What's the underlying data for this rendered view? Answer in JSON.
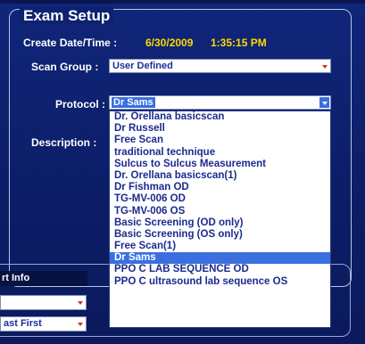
{
  "exam_setup": {
    "title": "Exam Setup",
    "create_label": "Create Date/Time :",
    "create_date": "6/30/2009",
    "create_time": "1:35:15 PM",
    "scan_group_label": "Scan Group :",
    "scan_group_value": "User Defined",
    "protocol_label": "Protocol :",
    "protocol_value": "Dr Sams",
    "description_label": "Description :"
  },
  "protocol_dropdown": {
    "options": [
      "Dr. Orellana basicscan",
      "Dr Russell",
      "Free Scan",
      "traditional technique",
      "Sulcus to Sulcus Measurement",
      "Dr. Orellana basicscan(1)",
      "Dr Fishman OD",
      "TG-MV-006 OD",
      "TG-MV-006 OS",
      "Basic Screening (OD only)",
      "Basic Screening (OS only)",
      "Free Scan(1)",
      "Dr Sams",
      "PPO C LAB SEQUENCE  OD",
      "PPO C ultrasound lab sequence OS"
    ],
    "selected_index": 12
  },
  "lower_panel": {
    "label": "rt Info",
    "field1_value": "",
    "field2_value": "ast First"
  },
  "colors": {
    "background": "#0d1f6e",
    "accent_yellow": "#ffd800",
    "selection_blue": "#3a6fe0"
  }
}
